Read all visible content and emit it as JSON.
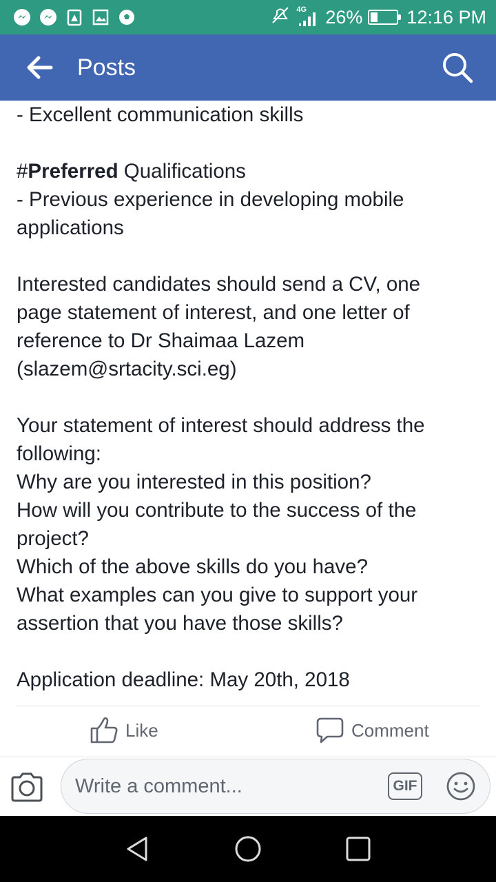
{
  "status_bar": {
    "network": "4G",
    "battery_percent": "26%",
    "battery_level": 0.26,
    "time": "12:16 PM",
    "left_icons": [
      "messenger-icon",
      "messenger-icon",
      "shield-alert-icon",
      "image-icon",
      "soccer-ball-icon"
    ],
    "right_icons": [
      "mute-icon",
      "signal-icon",
      "battery-icon"
    ]
  },
  "app_bar": {
    "title": "Posts",
    "back_icon": "arrow-left-icon",
    "search_icon": "search-icon",
    "background": "#4267b2"
  },
  "post": {
    "line_0": "- Excellent communication skills",
    "qual_hash": "#",
    "qual_bold": "Preferred",
    "qual_rest": " Qualifications",
    "qual_line_2": "- Previous experience in developing mobile",
    "qual_line_3": "applications",
    "apply_1": "Interested candidates should send a CV, one",
    "apply_2": "page statement of interest, and one letter of",
    "apply_3": "reference to Dr Shaimaa Lazem",
    "apply_4": "(slazem@srtacity.sci.eg)",
    "stmt_1": "Your statement of interest should address the",
    "stmt_2": "following:",
    "stmt_3": "Why are you interested in this position?",
    "stmt_4": "How will you contribute to the success of the",
    "stmt_5": "project?",
    "stmt_6": "Which of the above skills do you have?",
    "stmt_7": "What examples can you give to support your",
    "stmt_8": "assertion that you have those skills?",
    "deadline": "Application deadline: May 20th, 2018"
  },
  "actions": {
    "like_label": "Like",
    "like_icon": "thumbs-up-icon",
    "comment_label": "Comment",
    "comment_icon": "speech-bubble-icon"
  },
  "comment_bar": {
    "camera_icon": "camera-icon",
    "placeholder": "Write a comment...",
    "value": "",
    "gif_label": "GIF",
    "emoji_icon": "smiley-icon"
  },
  "nav_bar": {
    "icons": [
      "nav-back-icon",
      "nav-home-icon",
      "nav-recent-apps-icon"
    ]
  }
}
